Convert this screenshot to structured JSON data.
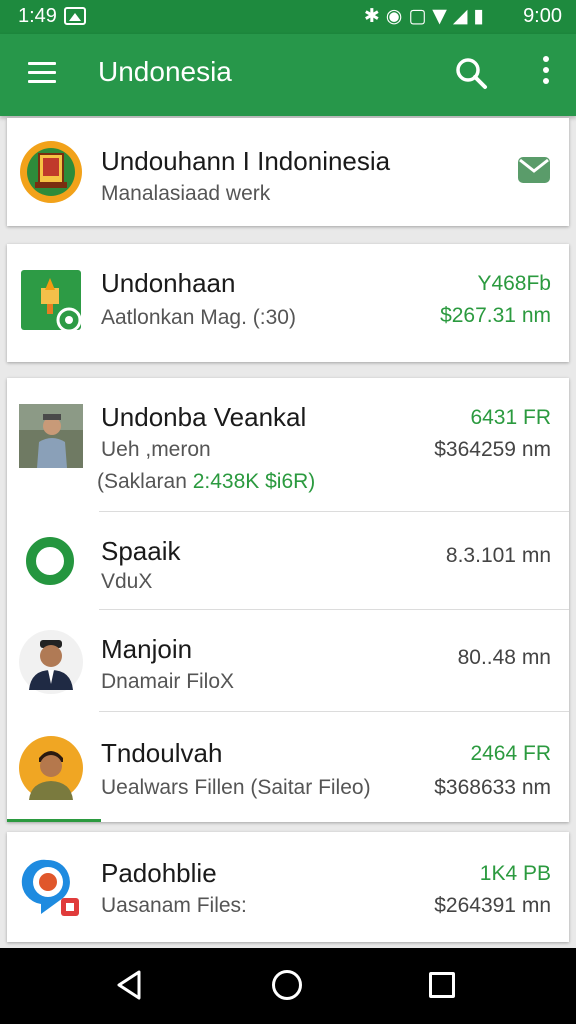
{
  "status_bar": {
    "time": "1:49",
    "clock": "9:00",
    "icons": [
      "notification-icon",
      "bluetooth-icon",
      "alarm-icon",
      "vibrate-icon",
      "wifi-icon",
      "signal-icon",
      "battery-icon"
    ]
  },
  "toolbar": {
    "title": "Undonesia",
    "icons": [
      "menu-icon",
      "search-icon",
      "overflow-icon"
    ]
  },
  "items": [
    {
      "title": "Undouhann I Indoninesia",
      "subtitle": "Manalasiaad werk",
      "icon": "emblem-icon"
    },
    {
      "title": "Undonhaan",
      "subtitle": "Aatlonkan Mag. (:30)",
      "right_top": "Y468Fb",
      "right_bottom": "$267.31 nm",
      "icon": "app-icon"
    },
    {
      "title": "Undonba  Veankal",
      "subtitle": "Ueh  ,meron",
      "subtitle2_prefix": "(Saklaran ",
      "subtitle2_green": "2:438K $i6R)",
      "right_top": "6431 FR",
      "right_bottom": "$364259 nm",
      "icon": "photo-avatar"
    },
    {
      "title": "Spaaik",
      "subtitle": "VduX",
      "right_bottom": "8.3.101 mn",
      "icon": "ring-icon"
    },
    {
      "title": "Manjoin",
      "subtitle": "Dnamair FiloX",
      "right_bottom": "80..48 mn",
      "icon": "person-avatar"
    },
    {
      "title": "Tndoulvah",
      "subtitle": "Uealwars Fillen  (Saitar Fileo)",
      "right_top": "2464 FR",
      "right_bottom": "$368633 nm",
      "icon": "person-avatar"
    },
    {
      "title": "Padohblie",
      "subtitle": "Uasanam Files:",
      "right_top": "1K4 PB",
      "right_bottom": "$264391 mn",
      "icon": "location-pin-icon"
    }
  ],
  "colors": {
    "primary": "#27974a",
    "status_bar": "#1e8a3e",
    "accent_text": "#2b9a3f"
  }
}
